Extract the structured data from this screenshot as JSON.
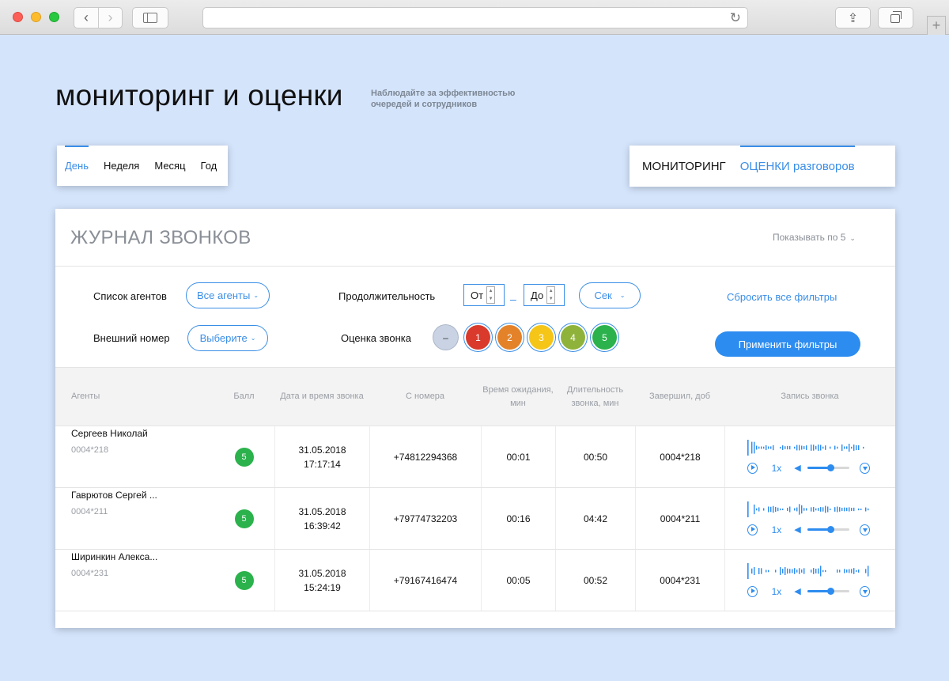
{
  "browser": {
    "back_glyph": "‹",
    "forward_glyph": "›",
    "reload_glyph": "↻",
    "share_glyph": "⇪",
    "new_tab_glyph": "+"
  },
  "header": {
    "title": "мониторинг и оценки",
    "subtitle": "Наблюдайте за эффективностью очередей и сотрудников"
  },
  "period_tabs": [
    {
      "label": "День",
      "active": true
    },
    {
      "label": "Неделя",
      "active": false
    },
    {
      "label": "Месяц",
      "active": false
    },
    {
      "label": "Год",
      "active": false
    }
  ],
  "mode_tabs": [
    {
      "label": "МОНИТОРИНГ",
      "active": false
    },
    {
      "label": "ОЦЕНКИ разговоров",
      "active": true
    }
  ],
  "journal": {
    "title": "ЖУРНАЛ ЗВОНКОВ",
    "page_size_label": "Показывать по 5",
    "chevron": "⌄"
  },
  "filters": {
    "agents_label": "Список агентов",
    "agents_value": "Все агенты",
    "external_label": "Внешний номер",
    "external_value": "Выберите",
    "duration_label": "Продолжительность",
    "from_label": "От",
    "to_label": "До",
    "range_dash": "–",
    "unit_value": "Сек",
    "rating_label": "Оценка звонка",
    "reset_label": "Сбросить все фильтры",
    "apply_label": "Применить фильтры",
    "ratings": [
      {
        "label": "–",
        "color": "#c9d3e3",
        "text_color": "#333"
      },
      {
        "label": "1",
        "color": "#d93a2b",
        "text_color": "#fff"
      },
      {
        "label": "2",
        "color": "#e4822a",
        "text_color": "#fff"
      },
      {
        "label": "3",
        "color": "#f5c518",
        "text_color": "#fff"
      },
      {
        "label": "4",
        "color": "#8fb33a",
        "text_color": "#fff"
      },
      {
        "label": "5",
        "color": "#2bb24c",
        "text_color": "#fff"
      }
    ]
  },
  "table": {
    "columns": {
      "agent": "Агенты",
      "score": "Балл",
      "datetime": "Дата и время звонка",
      "from": "С номера",
      "wait": "Время ожидания, мин",
      "duration": "Длительность звонка, мин",
      "ended_by": "Завершил, доб",
      "recording": "Запись звонка"
    },
    "rows": [
      {
        "agent": "Сергеев Николай",
        "ext": "0004*218",
        "score": "5",
        "date": "31.05.2018",
        "time": "17:17:14",
        "from": "+74812294368",
        "wait": "00:01",
        "duration": "00:50",
        "ended_by": "0004*218",
        "speed": "1x",
        "volume": 0.55
      },
      {
        "agent": "Гаврютов Сергей ...",
        "ext": "0004*211",
        "score": "5",
        "date": "31.05.2018",
        "time": "16:39:42",
        "from": "+79774732203",
        "wait": "00:16",
        "duration": "04:42",
        "ended_by": "0004*211",
        "speed": "1x",
        "volume": 0.55
      },
      {
        "agent": "Ширинкин Алекса...",
        "ext": "0004*231",
        "score": "5",
        "date": "31.05.2018",
        "time": "15:24:19",
        "from": "+79167416474",
        "wait": "00:05",
        "duration": "00:52",
        "ended_by": "0004*231",
        "speed": "1x",
        "volume": 0.55
      }
    ]
  },
  "colors": {
    "accent": "#2d8cf0",
    "badge_green": "#2bb24c",
    "background": "#d4e4fb"
  }
}
